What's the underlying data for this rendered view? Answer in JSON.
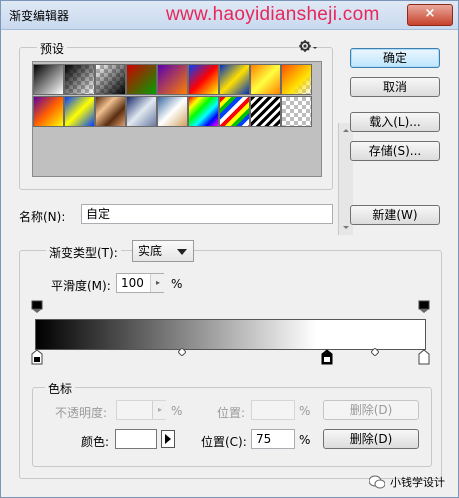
{
  "window": {
    "title": "渐变编辑器",
    "watermark": "www.haoyidiansheji.com",
    "close_glyph": "×"
  },
  "buttons": {
    "ok": "确定",
    "cancel": "取消",
    "load": "载入(L)...",
    "save": "存储(S)...",
    "new": "新建(W)",
    "delete_opacity": "删除(D)",
    "delete_color": "删除(D)"
  },
  "presets": {
    "label": "预设",
    "gear_icon": "gear-icon"
  },
  "name": {
    "label": "名称(N):",
    "value": "自定"
  },
  "gradient_type": {
    "label": "渐变类型(T):",
    "value": "实底"
  },
  "smoothness": {
    "label": "平滑度(M):",
    "value": "100",
    "unit": "%"
  },
  "color_stops_group": {
    "label": "色标",
    "opacity_label": "不透明度:",
    "opacity_unit": "%",
    "opacity_location_label": "位置:",
    "opacity_location_unit": "%",
    "color_label": "颜色:",
    "location_label": "位置(C):",
    "location_value": "75",
    "location_unit": "%"
  },
  "footer": {
    "brand": "小钱学设计"
  },
  "colors": {
    "accent": "#3c7fb1",
    "watermark": "#e8265a"
  }
}
